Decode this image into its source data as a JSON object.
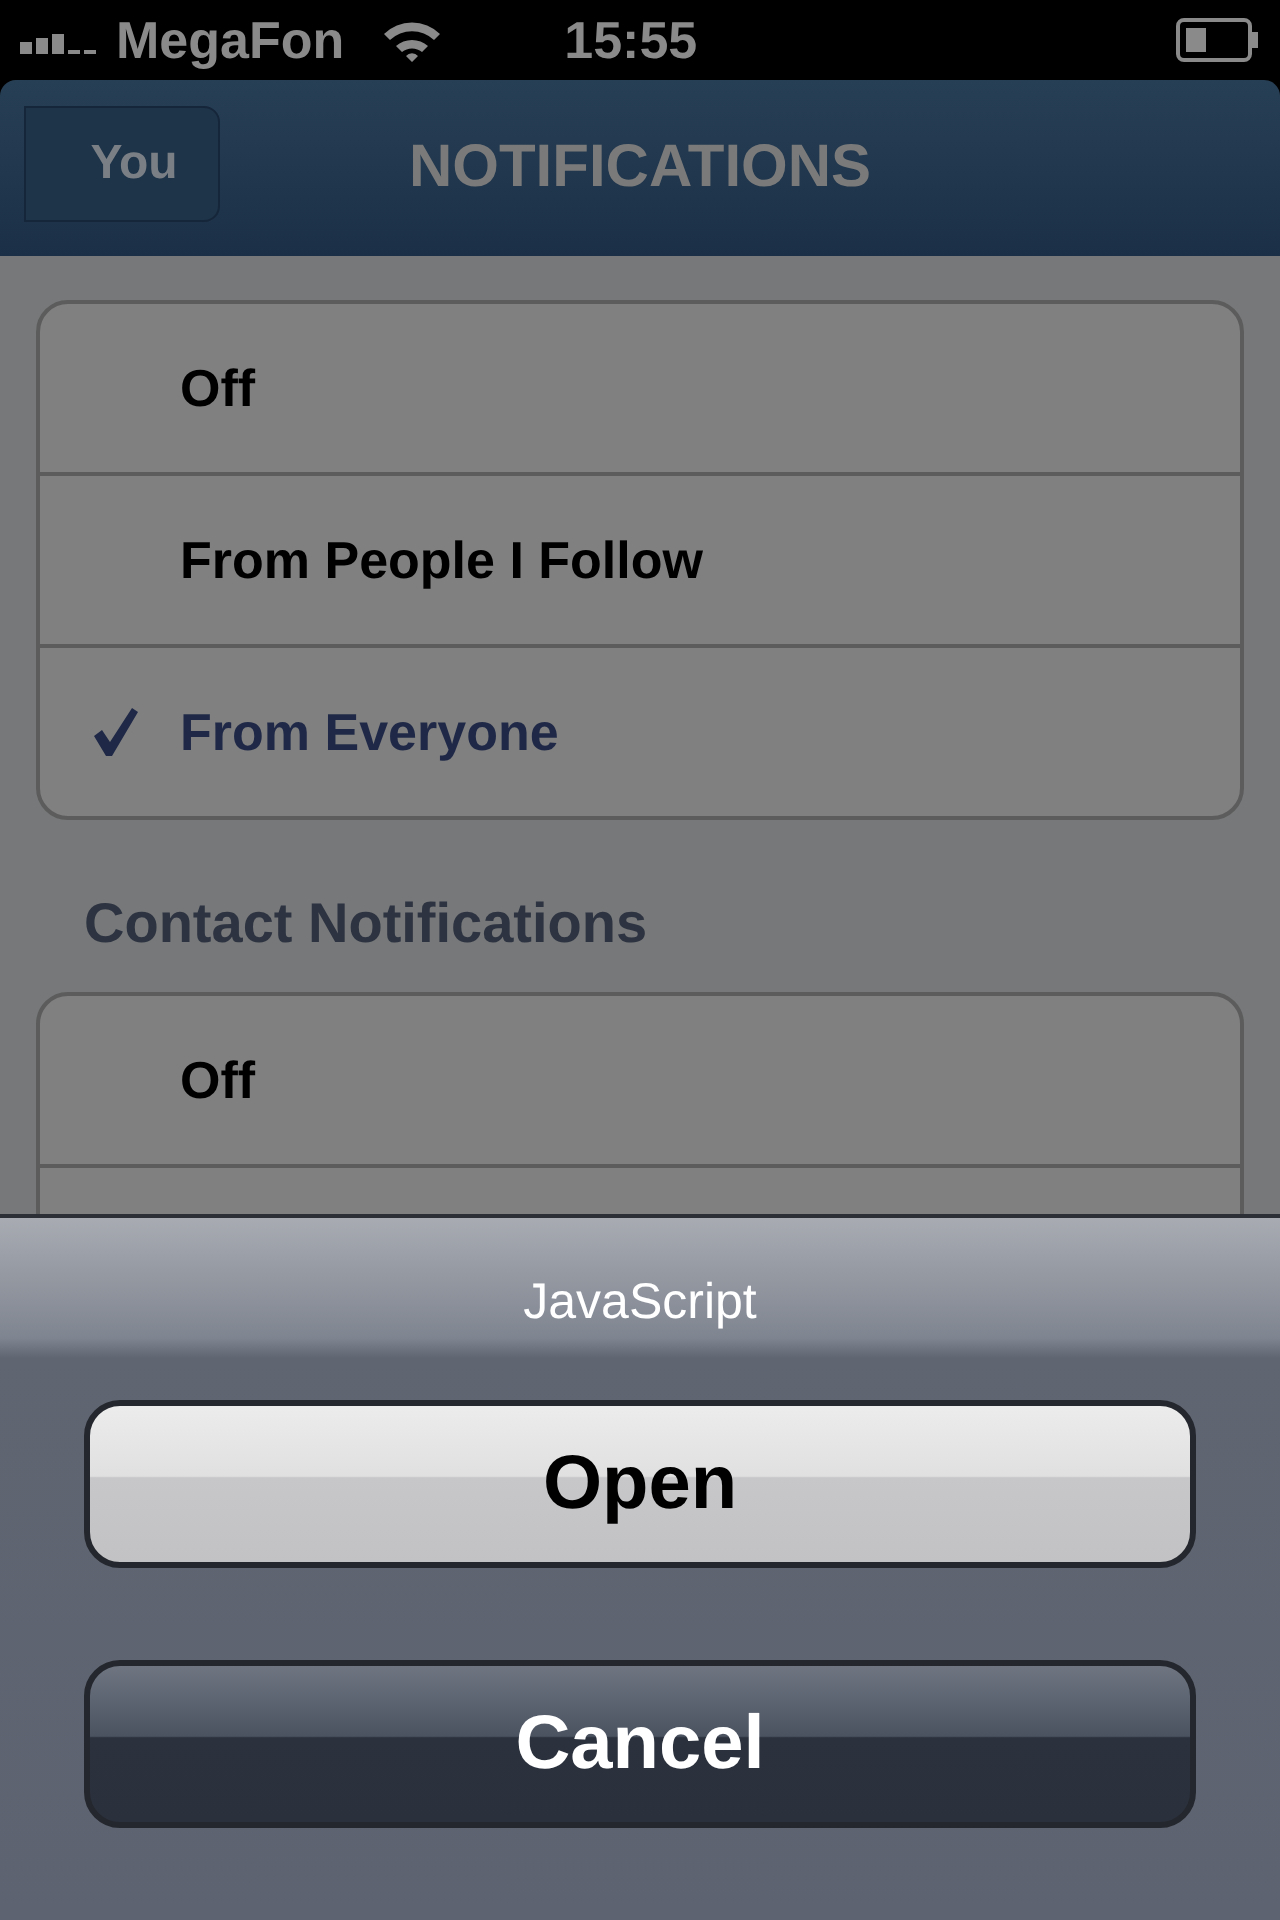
{
  "status_bar": {
    "carrier": "MegaFon",
    "time": "15:55"
  },
  "nav": {
    "back": "You",
    "title": "NOTIFICATIONS"
  },
  "groups": [
    {
      "options": [
        {
          "label": "Off",
          "selected": false
        },
        {
          "label": "From People I Follow",
          "selected": false
        },
        {
          "label": "From Everyone",
          "selected": true
        }
      ]
    },
    {
      "header": "Contact Notifications",
      "options": [
        {
          "label": "Off",
          "selected": false
        }
      ]
    }
  ],
  "action_sheet": {
    "title": "JavaScript",
    "buttons": [
      {
        "label": "Open",
        "kind": "default"
      },
      {
        "label": "Cancel",
        "kind": "cancel"
      }
    ]
  }
}
